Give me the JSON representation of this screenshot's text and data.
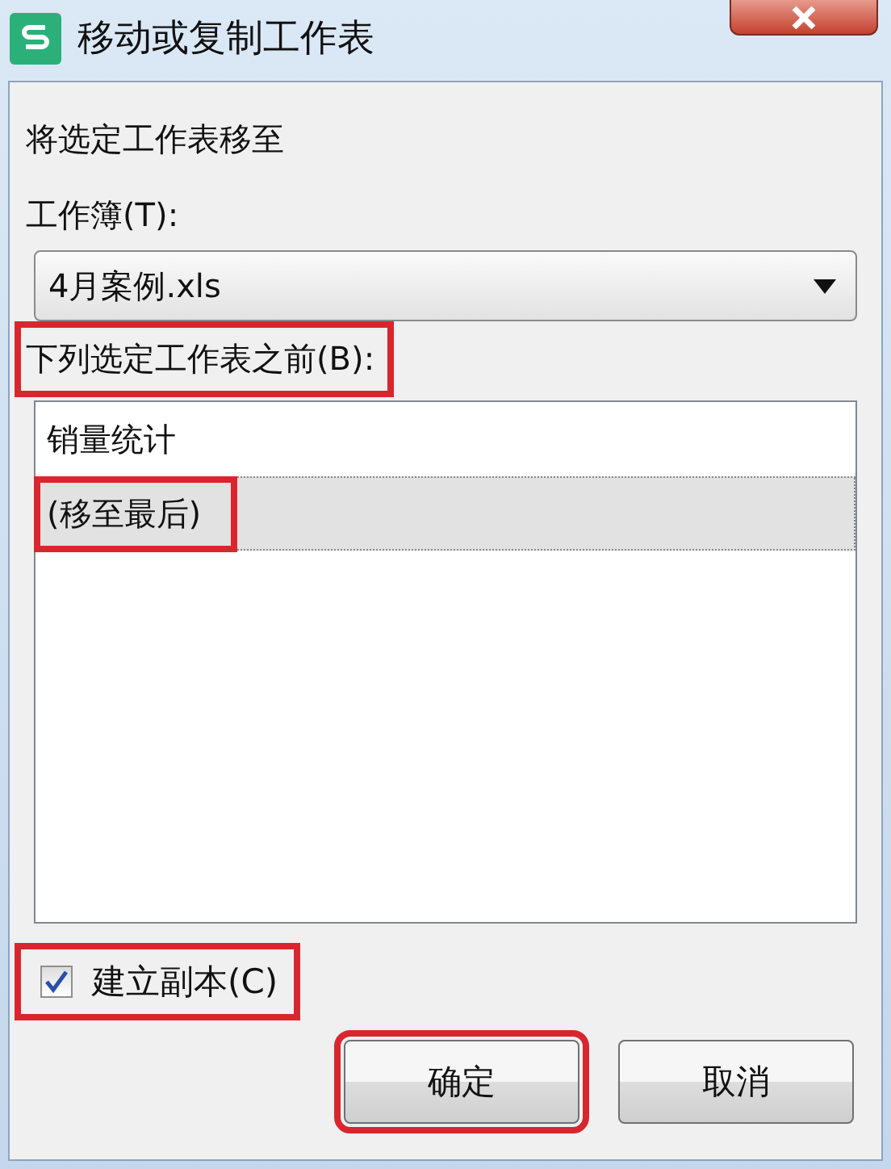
{
  "window": {
    "title": "移动或复制工作表"
  },
  "prompt": "将选定工作表移至",
  "workbook": {
    "label": "工作簿(T):",
    "value": "4月案例.xls"
  },
  "before": {
    "label": "下列选定工作表之前(B):",
    "highlighted": true
  },
  "sheets": [
    {
      "label": "销量统计",
      "selected": false,
      "highlighted": false
    },
    {
      "label": "(移至最后)",
      "selected": true,
      "highlighted": true
    }
  ],
  "copy": {
    "label": "建立副本(C)",
    "checked": true,
    "highlighted": true
  },
  "buttons": [
    {
      "label": "确定",
      "highlighted": true
    },
    {
      "label": "取消",
      "highlighted": false
    }
  ]
}
